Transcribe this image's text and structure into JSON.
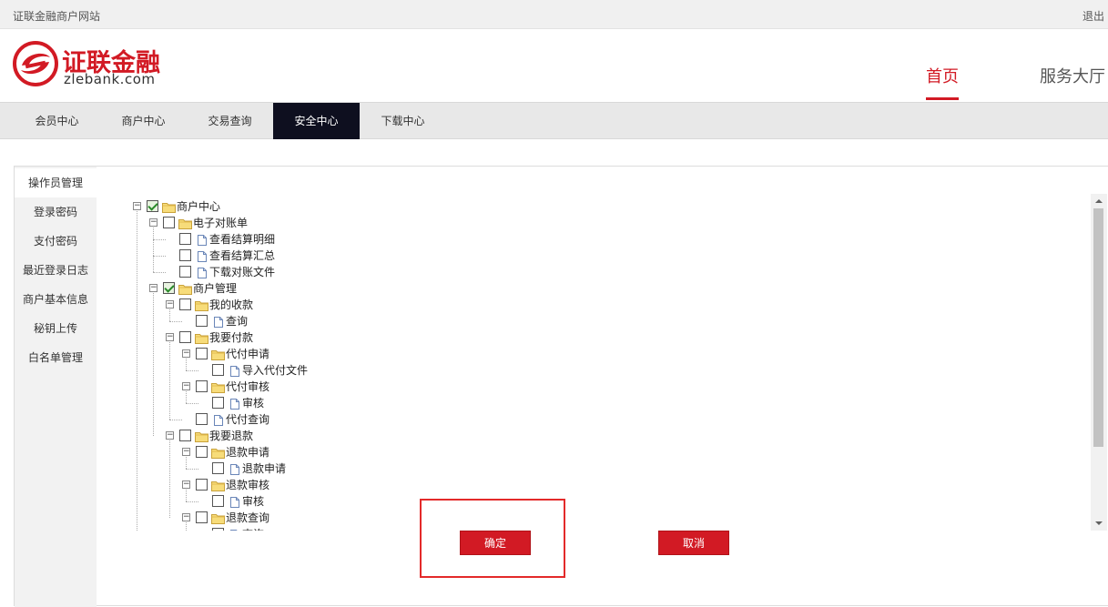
{
  "topbar": {
    "site_name": "证联金融商户网站",
    "logout": "退出"
  },
  "logo": {
    "cn": "证联金融",
    "en": "zlebank.com"
  },
  "topnav": [
    {
      "label": "首页",
      "active": true
    },
    {
      "label": "服务大厅",
      "active": false
    }
  ],
  "menu": [
    {
      "label": "会员中心",
      "active": false
    },
    {
      "label": "商户中心",
      "active": false
    },
    {
      "label": "交易查询",
      "active": false
    },
    {
      "label": "安全中心",
      "active": true
    },
    {
      "label": "下载中心",
      "active": false
    }
  ],
  "sidebar": [
    {
      "label": "操作员管理",
      "active": true
    },
    {
      "label": "登录密码",
      "active": false
    },
    {
      "label": "支付密码",
      "active": false
    },
    {
      "label": "最近登录日志",
      "active": false
    },
    {
      "label": "商户基本信息",
      "active": false
    },
    {
      "label": "秘钥上传",
      "active": false
    },
    {
      "label": "白名单管理",
      "active": false
    }
  ],
  "tree": [
    {
      "label": "商户中心",
      "level": 0,
      "type": "folder",
      "expandable": true,
      "checked": true
    },
    {
      "label": "电子对账单",
      "level": 1,
      "type": "folder",
      "expandable": true,
      "checked": false
    },
    {
      "label": "查看结算明细",
      "level": 2,
      "type": "file",
      "expandable": false,
      "checked": false
    },
    {
      "label": "查看结算汇总",
      "level": 2,
      "type": "file",
      "expandable": false,
      "checked": false
    },
    {
      "label": "下载对账文件",
      "level": 2,
      "type": "file",
      "expandable": false,
      "checked": false
    },
    {
      "label": "商户管理",
      "level": 1,
      "type": "folder",
      "expandable": true,
      "checked": true
    },
    {
      "label": "我的收款",
      "level": 2,
      "type": "folder",
      "expandable": true,
      "checked": false
    },
    {
      "label": "查询",
      "level": 3,
      "type": "file",
      "expandable": false,
      "checked": false
    },
    {
      "label": "我要付款",
      "level": 2,
      "type": "folder",
      "expandable": true,
      "checked": false
    },
    {
      "label": "代付申请",
      "level": 3,
      "type": "folder",
      "expandable": true,
      "checked": false
    },
    {
      "label": "导入代付文件",
      "level": 4,
      "type": "file",
      "expandable": false,
      "checked": false
    },
    {
      "label": "代付审核",
      "level": 3,
      "type": "folder",
      "expandable": true,
      "checked": false
    },
    {
      "label": "审核",
      "level": 4,
      "type": "file",
      "expandable": false,
      "checked": false
    },
    {
      "label": "代付查询",
      "level": 3,
      "type": "file",
      "expandable": false,
      "checked": false
    },
    {
      "label": "我要退款",
      "level": 2,
      "type": "folder",
      "expandable": true,
      "checked": false
    },
    {
      "label": "退款申请",
      "level": 3,
      "type": "folder",
      "expandable": true,
      "checked": false
    },
    {
      "label": "退款申请",
      "level": 4,
      "type": "file",
      "expandable": false,
      "checked": false
    },
    {
      "label": "退款审核",
      "level": 3,
      "type": "folder",
      "expandable": true,
      "checked": false
    },
    {
      "label": "审核",
      "level": 4,
      "type": "file",
      "expandable": false,
      "checked": false
    },
    {
      "label": "退款查询",
      "level": 3,
      "type": "folder",
      "expandable": true,
      "checked": false
    },
    {
      "label": "查询",
      "level": 4,
      "type": "file",
      "expandable": false,
      "checked": false
    }
  ],
  "buttons": {
    "confirm": "确定",
    "cancel": "取消"
  },
  "colors": {
    "brand_red": "#d21a24",
    "menu_active_bg": "#0e0f1f",
    "highlight": "#e32a2a"
  }
}
